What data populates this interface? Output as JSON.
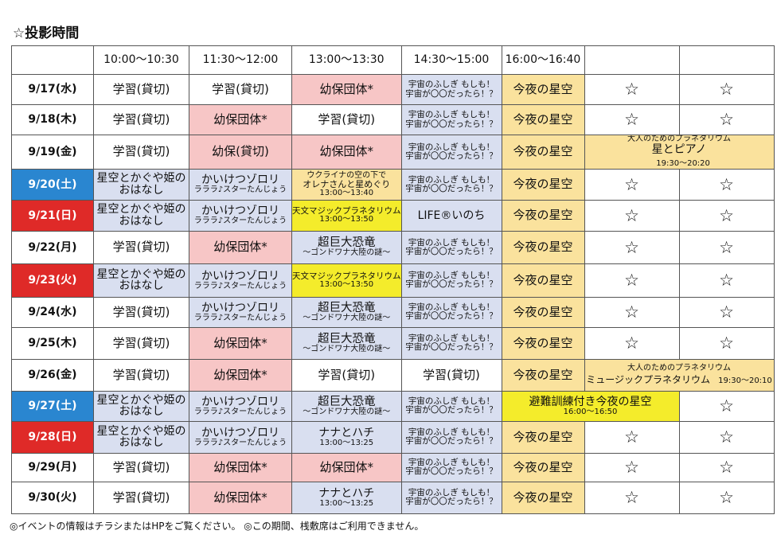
{
  "title": "☆投影時間",
  "headers": [
    "",
    "10:00～10:30",
    "11:30～12:00",
    "13:00～13:30",
    "14:30～15:00",
    "16:00～16:40",
    "",
    ""
  ],
  "rows": [
    {
      "date": "9/17(水)",
      "c1": "学習(貸切)",
      "c2": "学習(貸切)",
      "c3": "幼保団体*",
      "c4a": "宇宙のふしぎ もしも！",
      "c4b": "宇宙が〇〇だったら！？",
      "c5": "今夜の星空",
      "c6": "☆",
      "c7": "☆"
    },
    {
      "date": "9/18(木)",
      "c1": "学習(貸切)",
      "c2": "幼保団体*",
      "c3": "学習(貸切)",
      "c4a": "宇宙のふしぎ もしも！",
      "c4b": "宇宙が〇〇だったら！？",
      "c5": "今夜の星空",
      "c6": "☆",
      "c7": "☆"
    },
    {
      "date": "9/19(金)",
      "c1": "学習(貸切)",
      "c2": "幼保(貸切)",
      "c3": "幼保団体*",
      "c4a": "宇宙のふしぎ もしも！",
      "c4b": "宇宙が〇〇だったら！？",
      "c5": "今夜の星空",
      "ev1": "大人のためのプラネタリウム",
      "ev2": "星とピアノ",
      "ev3": "19:30～20:20"
    },
    {
      "date": "9/20(土)",
      "c1a": "星空とかぐや姫の",
      "c1b": "おはなし",
      "c2a": "かいけつゾロリ",
      "c2b": "ラララ♪スターたんじょう",
      "c3a": "ウクライナの空の下で",
      "c3b": "オレナさんと星めぐり",
      "c3c": "13:00～13:40",
      "c4a": "宇宙のふしぎ もしも！",
      "c4b": "宇宙が〇〇だったら！？",
      "c5": "今夜の星空",
      "c6": "☆",
      "c7": "☆"
    },
    {
      "date": "9/21(日)",
      "c1a": "星空とかぐや姫の",
      "c1b": "おはなし",
      "c2a": "かいけつゾロリ",
      "c2b": "ラララ♪スターたんじょう",
      "c3a": "天文マジックプラネタリウム",
      "c3b": "13:00～13:50",
      "c4": "LIFE®いのち",
      "c5": "今夜の星空",
      "c6": "☆",
      "c7": "☆"
    },
    {
      "date": "9/22(月)",
      "c1": "学習(貸切)",
      "c2": "幼保団体*",
      "c3a": "超巨大恐竜",
      "c3b": "～ゴンドワナ大陸の謎～",
      "c4a": "宇宙のふしぎ もしも！",
      "c4b": "宇宙が〇〇だったら！？",
      "c5": "今夜の星空",
      "c6": "☆",
      "c7": "☆"
    },
    {
      "date": "9/23(火)",
      "c1a": "星空とかぐや姫の",
      "c1b": "おはなし",
      "c2a": "かいけつゾロリ",
      "c2b": "ラララ♪スターたんじょう",
      "c3a": "天文マジックプラネタリウム",
      "c3b": "13:00～13:50",
      "c4a": "宇宙のふしぎ もしも！",
      "c4b": "宇宙が〇〇だったら！？",
      "c5": "今夜の星空",
      "c6": "☆",
      "c7": "☆"
    },
    {
      "date": "9/24(水)",
      "c1": "学習(貸切)",
      "c2a": "かいけつゾロリ",
      "c2b": "ラララ♪スターたんじょう",
      "c3a": "超巨大恐竜",
      "c3b": "～ゴンドワナ大陸の謎～",
      "c4a": "宇宙のふしぎ もしも！",
      "c4b": "宇宙が〇〇だったら！？",
      "c5": "今夜の星空",
      "c6": "☆",
      "c7": "☆"
    },
    {
      "date": "9/25(木)",
      "c1": "学習(貸切)",
      "c2": "幼保団体*",
      "c3a": "超巨大恐竜",
      "c3b": "～ゴンドワナ大陸の謎～",
      "c4a": "宇宙のふしぎ もしも！",
      "c4b": "宇宙が〇〇だったら！？",
      "c5": "今夜の星空",
      "c6": "☆",
      "c7": "☆"
    },
    {
      "date": "9/26(金)",
      "c1": "学習(貸切)",
      "c2": "幼保団体*",
      "c3": "学習(貸切)",
      "c4": "学習(貸切)",
      "c5": "今夜の星空",
      "ev1": "大人のためのプラネタリウム",
      "ev2": "ミュージックプラネタリウム",
      "ev3": "19:30～20:10"
    },
    {
      "date": "9/27(土)",
      "c1a": "星空とかぐや姫の",
      "c1b": "おはなし",
      "c2a": "かいけつゾロリ",
      "c2b": "ラララ♪スターたんじょう",
      "c3a": "超巨大恐竜",
      "c3b": "～ゴンドワナ大陸の謎～",
      "c4a": "宇宙のふしぎ もしも！",
      "c4b": "宇宙が〇〇だったら！？",
      "ev1": "避難訓練付き今夜の星空",
      "ev2": "16:00～16:50",
      "c7": "☆"
    },
    {
      "date": "9/28(日)",
      "c1a": "星空とかぐや姫の",
      "c1b": "おはなし",
      "c2a": "かいけつゾロリ",
      "c2b": "ラララ♪スターたんじょう",
      "c3a": "ナナとハチ",
      "c3b": "13:00～13:25",
      "c4a": "宇宙のふしぎ もしも！",
      "c4b": "宇宙が〇〇だったら！？",
      "c5": "今夜の星空",
      "c6": "☆",
      "c7": "☆"
    },
    {
      "date": "9/29(月)",
      "c1": "学習(貸切)",
      "c2": "幼保団体*",
      "c3": "幼保団体*",
      "c4a": "宇宙のふしぎ もしも！",
      "c4b": "宇宙が〇〇だったら！？",
      "c5": "今夜の星空",
      "c6": "☆",
      "c7": "☆"
    },
    {
      "date": "9/30(火)",
      "c1": "学習(貸切)",
      "c2": "幼保団体*",
      "c3a": "ナナとハチ",
      "c3b": "13:00～13:25",
      "c4a": "宇宙のふしぎ もしも！",
      "c4b": "宇宙が〇〇だったら！？",
      "c5": "今夜の星空",
      "c6": "☆",
      "c7": "☆"
    }
  ],
  "colors": {
    "pink": "#f7c6c6",
    "lavender": "#d9dff0",
    "yellow": "#fae29d",
    "bright_yellow": "#f4ec2b",
    "saturday_blue": "#2a86d0",
    "holiday_red": "#df2a28"
  },
  "footnote": "◎イベントの情報はチラシまたはHPをご覧ください。 ◎この期間、桟敷席はご利用できません。"
}
